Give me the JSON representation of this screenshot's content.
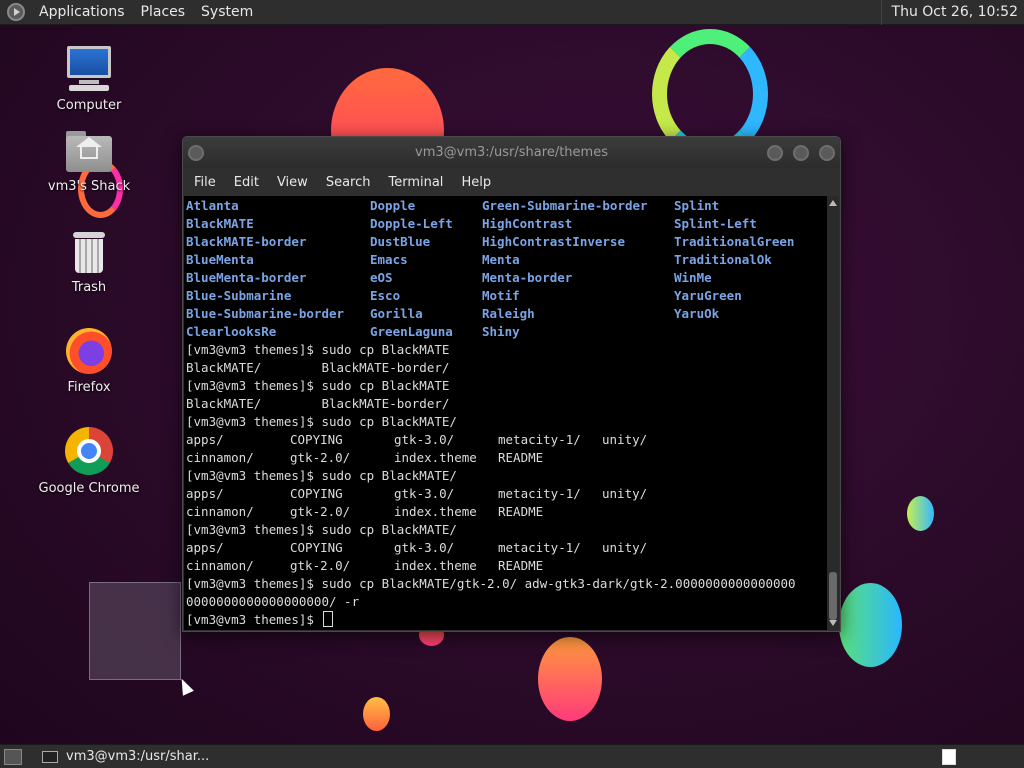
{
  "top_panel": {
    "menus": [
      "Applications",
      "Places",
      "System"
    ],
    "clock": "Thu Oct 26, 10:52"
  },
  "desktop": {
    "icons": [
      {
        "label": "Computer",
        "icon": "computer-icon"
      },
      {
        "label": "vm3's Shack",
        "icon": "home-folder-icon"
      },
      {
        "label": "Trash",
        "icon": "trash-icon"
      },
      {
        "label": "Firefox",
        "icon": "firefox-icon"
      },
      {
        "label": "Google Chrome",
        "icon": "chrome-icon"
      }
    ]
  },
  "terminal": {
    "title": "vm3@vm3:/usr/share/themes",
    "menu": [
      "File",
      "Edit",
      "View",
      "Search",
      "Terminal",
      "Help"
    ],
    "theme_columns": [
      [
        "Atlanta",
        "Dopple",
        "Green-Submarine-border",
        "Splint"
      ],
      [
        "BlackMATE",
        "Dopple-Left",
        "HighContrast",
        "Splint-Left"
      ],
      [
        "BlackMATE-border",
        "DustBlue",
        "HighContrastInverse",
        "TraditionalGreen"
      ],
      [
        "BlueMenta",
        "Emacs",
        "Menta",
        "TraditionalOk"
      ],
      [
        "BlueMenta-border",
        "eOS",
        "Menta-border",
        "WinMe"
      ],
      [
        "Blue-Submarine",
        "Esco",
        "Motif",
        "YaruGreen"
      ],
      [
        "Blue-Submarine-border",
        "Gorilla",
        "Raleigh",
        "YaruOk"
      ],
      [
        "ClearlooksRe",
        "GreenLaguna",
        "Shiny",
        ""
      ]
    ],
    "lines": {
      "p1": "[vm3@vm3 themes]$ sudo cp BlackMATE",
      "c1": "BlackMATE/        BlackMATE-border/",
      "p2": "[vm3@vm3 themes]$ sudo cp BlackMATE",
      "c2": "BlackMATE/        BlackMATE-border/",
      "p3": "[vm3@vm3 themes]$ sudo cp BlackMATE/",
      "p4": "[vm3@vm3 themes]$ sudo cp BlackMATE/",
      "p5": "[vm3@vm3 themes]$ sudo cp BlackMATE/",
      "p6": "[vm3@vm3 themes]$ sudo cp BlackMATE/gtk-2.0/ adw-gtk3-dark/gtk-2.0000000000000000",
      "p6b": "0000000000000000000/ -r",
      "prompt": "[vm3@vm3 themes]$ "
    },
    "ls_row1": [
      "apps/",
      "COPYING",
      "gtk-3.0/",
      "metacity-1/",
      "unity/"
    ],
    "ls_row2": [
      "cinnamon/",
      "gtk-2.0/",
      "index.theme",
      "README",
      ""
    ]
  },
  "taskbar": {
    "task_label": "vm3@vm3:/usr/shar..."
  },
  "colors": {
    "directory_blue": "#7aa4e6",
    "terminal_bg": "#000000",
    "panel_bg": "#2e2e2e"
  }
}
